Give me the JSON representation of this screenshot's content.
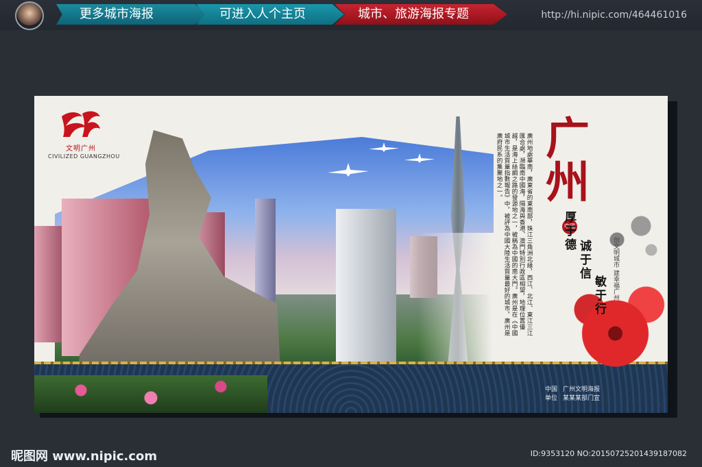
{
  "topbar": {
    "tabs": [
      {
        "label": "更多城市海报"
      },
      {
        "label": "可进入人个主页"
      },
      {
        "label": "城市、旅游海报专题"
      }
    ],
    "url": "http://hi.nipic.com/464461016"
  },
  "poster": {
    "logo": {
      "cn": "文明广州",
      "en": "CIVILIZED GUANGZHOU"
    },
    "title": "广州",
    "slogans": [
      "厚于德",
      "诚于信",
      "敏于行"
    ],
    "seal_text": "中國夢",
    "side_small": "创文明城市 建幸福广州",
    "body_text": "廣州地處華南，廣東省的東南部，珠江三角洲北緣，西江、北江、東江三江匯合處，瀕臨南中國海，隔海與香港、澳門特別行政區相望，地理位置優越，是海上絲綢之路的發源地之一，被稱為中國的南大門。廣州是在《中國城市生活質量指數報告》中，被評為中國大陸生活質量最好的城市，廣州是廣府民系的集聚地之一。",
    "footer": [
      {
        "k": "中国",
        "v": "广州文明海报"
      },
      {
        "k": "单位",
        "v": "某某某部门宣"
      }
    ],
    "colors": {
      "accent": "#a8121b",
      "band": "#1f3651",
      "gold": "#d8b248"
    }
  },
  "bottom": {
    "site": "昵图网 www.nipic.com",
    "id": "ID:9353120 NO:20150725201439187082"
  }
}
